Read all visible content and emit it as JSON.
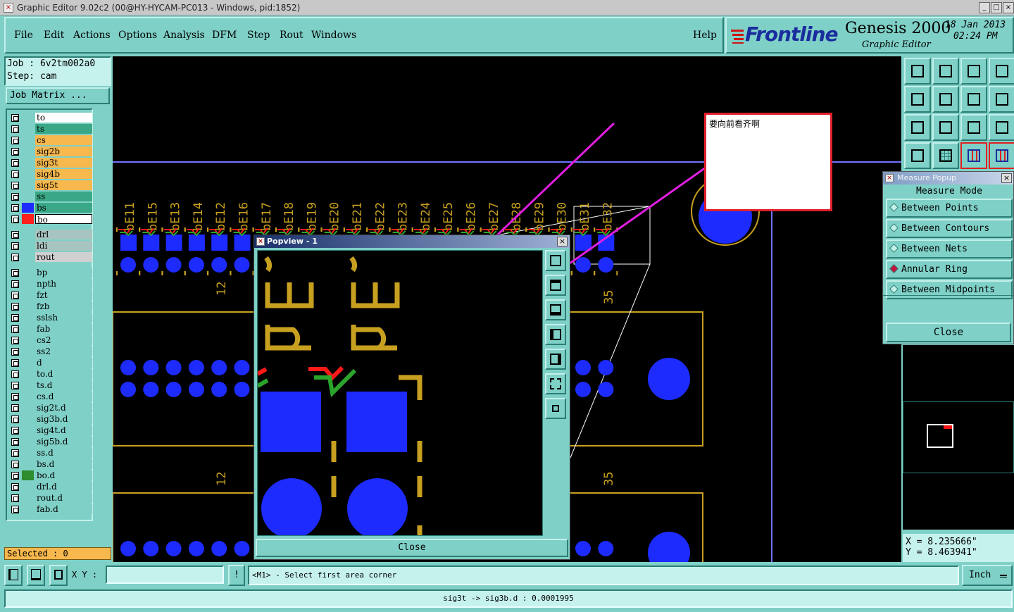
{
  "window": {
    "title": "Graphic Editor 9.02c2 (00@HY-HYCAM-PC013 - Windows, pid:1852)",
    "minimize": "_",
    "maximize": "□",
    "close": "×"
  },
  "menu": {
    "items": [
      "File",
      "Edit",
      "Actions",
      "Options",
      "Analysis",
      "DFM",
      "Step",
      "Rout",
      "Windows"
    ],
    "help": "Help"
  },
  "brand": {
    "logo": "Frontline",
    "product": "Genesis 2000",
    "subtitle": "Graphic Editor",
    "date": "18 Jan 2013",
    "time": "02:24 PM"
  },
  "job": {
    "job_label": "Job : 6v2tm002a0",
    "step_label": "Step: cam",
    "matrix_button": "Job Matrix ..."
  },
  "layers": {
    "group1": [
      {
        "name": "to",
        "color": "#ffffff",
        "swatch": "",
        "mark": "pen"
      },
      {
        "name": "ts",
        "color": "#3aa886",
        "swatch": "",
        "mark": ""
      },
      {
        "name": "cs",
        "color": "#f7b84e",
        "swatch": "",
        "mark": ""
      },
      {
        "name": "sig2b",
        "color": "#f7b84e",
        "swatch": "",
        "mark": ""
      },
      {
        "name": "sig3t",
        "color": "#f7b84e",
        "swatch": "",
        "mark": ""
      },
      {
        "name": "sig4b",
        "color": "#f7b84e",
        "swatch": "",
        "mark": ""
      },
      {
        "name": "sig5t",
        "color": "#f7b84e",
        "swatch": "",
        "mark": ""
      },
      {
        "name": "ss",
        "color": "#3aa886",
        "swatch": "",
        "mark": ""
      },
      {
        "name": "bs",
        "color": "#3aa886",
        "swatch": "#1e2bff",
        "mark": ""
      },
      {
        "name": "bo",
        "color": "#ffffff",
        "swatch": "#ff2020",
        "mark": "pen-box",
        "active": true
      }
    ],
    "group2": [
      {
        "name": "drl",
        "color": "#a8c4c0"
      },
      {
        "name": "ldi",
        "color": "#a8c4c0"
      },
      {
        "name": "rout",
        "color": "#d0d0d0"
      }
    ],
    "group3": [
      {
        "name": "bp",
        "mark": ""
      },
      {
        "name": "npth",
        "mark": ""
      },
      {
        "name": "fzt",
        "mark": ""
      },
      {
        "name": "fzb",
        "mark": ""
      },
      {
        "name": "sslsh",
        "mark": ""
      },
      {
        "name": "fab",
        "mark": "pen"
      },
      {
        "name": "cs2",
        "mark": ""
      },
      {
        "name": "ss2",
        "mark": ""
      },
      {
        "name": "d",
        "mark": ""
      },
      {
        "name": "to.d",
        "mark": "pen"
      },
      {
        "name": "ts.d",
        "mark": ""
      },
      {
        "name": "cs.d",
        "mark": ""
      },
      {
        "name": "sig2t.d",
        "mark": ""
      },
      {
        "name": "sig3b.d",
        "mark": ""
      },
      {
        "name": "sig4t.d",
        "mark": ""
      },
      {
        "name": "sig5b.d",
        "mark": ""
      },
      {
        "name": "ss.d",
        "mark": ""
      },
      {
        "name": "bs.d",
        "mark": ""
      },
      {
        "name": "bo.d",
        "mark": "pen",
        "swatch": "#2e8b2e"
      },
      {
        "name": "drl.d",
        "mark": ""
      },
      {
        "name": "rout.d",
        "mark": ""
      },
      {
        "name": "fab.d",
        "mark": ""
      }
    ]
  },
  "selected": "Selected : 0",
  "canvas": {
    "pin_labels": [
      "bE11",
      "bE15",
      "bE13",
      "bE14",
      "bE12",
      "bE16",
      "bE17",
      "bE18",
      "bE19",
      "bE20",
      "bE21",
      "bE22",
      "bE23",
      "bE24",
      "bE25",
      "bE26",
      "bE27",
      "bE28",
      "bE29",
      "bE30",
      "bE31",
      "bE32"
    ],
    "side_label_12": "12",
    "side_label_35": "35",
    "annotation_text": "要向前看齐啊"
  },
  "popview": {
    "title": "Popview - 1",
    "close_button": "Close",
    "close_x": "×"
  },
  "measure": {
    "title": "Measure Popup",
    "mode_label": "Measure Mode",
    "options": [
      {
        "label": "Between Points",
        "selected": false
      },
      {
        "label": "Between Contours",
        "selected": false
      },
      {
        "label": "Between Nets",
        "selected": false
      },
      {
        "label": "Annular Ring",
        "selected": true
      },
      {
        "label": "Between Midpoints",
        "selected": false
      }
    ],
    "close_button": "Close",
    "close_x": "×"
  },
  "coords": {
    "x": "X = 8.235666\"",
    "y": "Y = 8.463941\""
  },
  "status": {
    "xy_label": "X Y :",
    "xy_value": "",
    "prompt": "<M1> - Select first area corner",
    "units": "Inch",
    "info_icon": "!"
  },
  "bottom": {
    "message": "sig3t -> sig3b.d : 0.0001995"
  },
  "colors": {
    "panel": "#7fd0c7",
    "pad_blue": "#1e2bff",
    "silkscreen": "#c8a020",
    "annotation_arrow": "#e01ee0",
    "trace_red": "#ff1a1a",
    "trace_green": "#2aa52a"
  }
}
